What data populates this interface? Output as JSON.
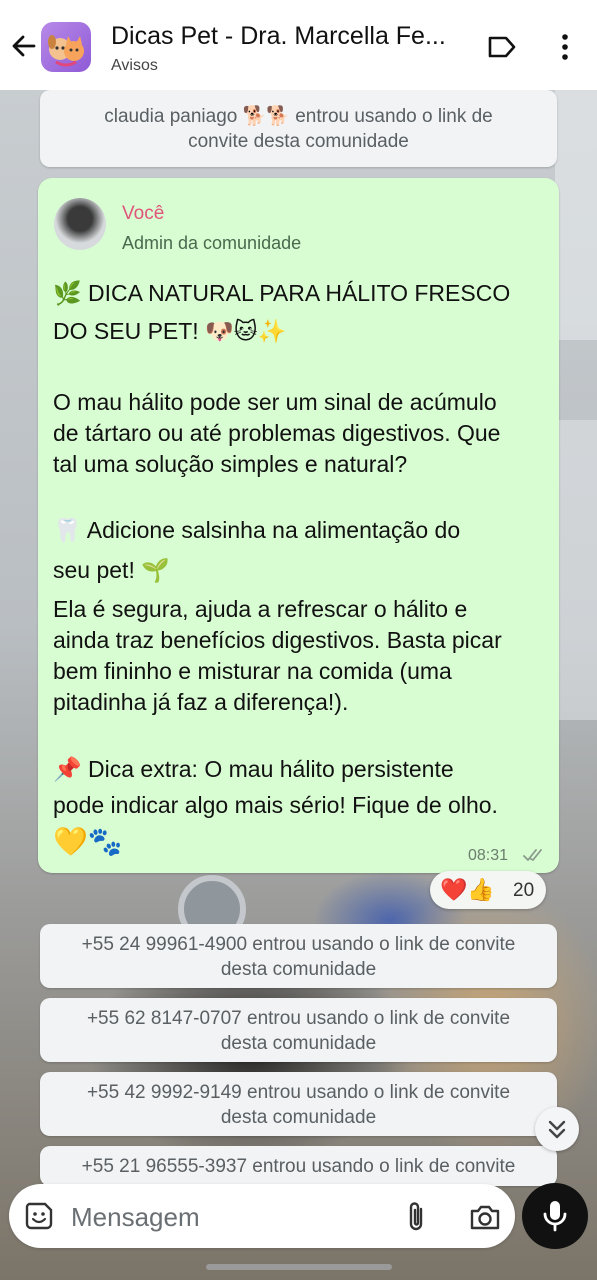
{
  "header": {
    "back_label": "Voltar",
    "title": "Dicas Pet - Dra. Marcella Fe...",
    "subtitle": "Avisos",
    "icons": [
      "back-arrow-icon",
      "label-icon",
      "more-vertical-icon"
    ]
  },
  "system_messages": [
    {
      "line1": "claudia paniago 🐕🐕 entrou usando o link de",
      "line2": "convite desta comunidade"
    },
    {
      "line1": "+55 24 99961-4900 entrou usando o link de convite",
      "line2": "desta comunidade"
    },
    {
      "line1": "+55 62 8147-0707 entrou usando o link de convite",
      "line2": "desta comunidade"
    },
    {
      "line1": "+55 42 9992-9149 entrou usando o link de convite",
      "line2": "desta comunidade"
    },
    {
      "line1": "+55 21 96555-3937 entrou usando o link de convite",
      "line2": ""
    }
  ],
  "message": {
    "sender_name": "Você",
    "sender_role": "Admin da comunidade",
    "lines": [
      "🌿 DICA NATURAL PARA HÁLITO FRESCO",
      "DO SEU PET! 🐶🐱✨",
      "O mau hálito pode ser um sinal de acúmulo",
      "de tártaro ou até problemas digestivos. Que",
      "tal uma solução simples e natural?",
      "🦷 Adicione salsinha na alimentação do",
      "seu pet! 🌱",
      "Ela é segura, ajuda a refrescar o hálito e",
      "ainda traz benefícios digestivos. Basta picar",
      "bem fininho e misturar na comida (uma",
      "pitadinha já faz a diferença!).",
      "📌 Dica extra: O mau hálito persistente",
      "pode indicar algo mais sério! Fique de olho.",
      "💛🐾"
    ],
    "time": "08:31",
    "status": "delivered-ticks"
  },
  "reactions": {
    "emojis": "❤️👍",
    "count": "20"
  },
  "composer": {
    "placeholder": "Mensagem",
    "icons": [
      "sticker-icon",
      "attach-icon",
      "camera-icon",
      "microphone-icon"
    ]
  },
  "colors": {
    "bubble": "#d9fdd3",
    "sender_name": "#e0557a",
    "system_bg": "#f1f3f4"
  }
}
